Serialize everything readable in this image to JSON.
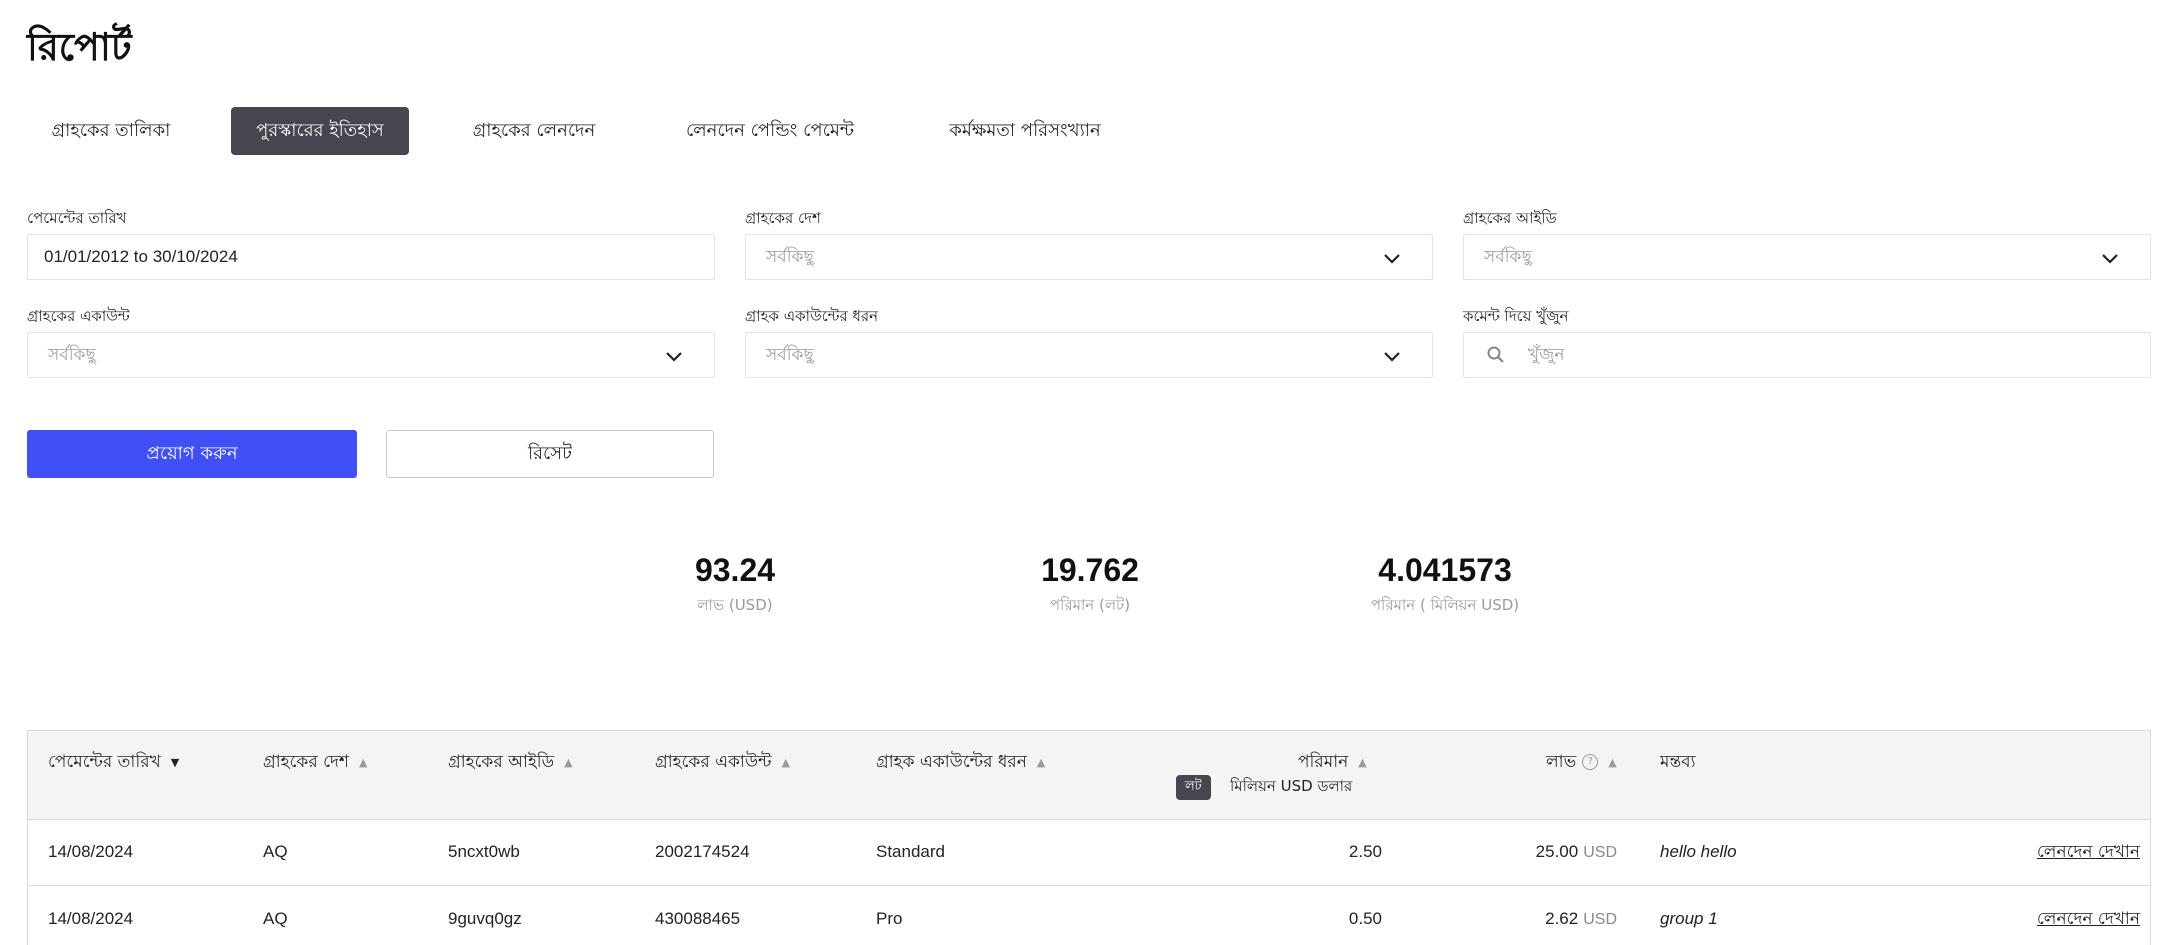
{
  "page_title": "রিপোর্ট",
  "tabs": [
    {
      "label": "গ্রাহকের তালিকা",
      "active": false
    },
    {
      "label": "পুরস্কারের ইতিহাস",
      "active": true
    },
    {
      "label": "গ্রাহকের লেনদেন",
      "active": false
    },
    {
      "label": "লেনদেন পেন্ডিং পেমেন্ট",
      "active": false
    },
    {
      "label": "কর্মক্ষমতা পরিসংখ্যান",
      "active": false
    }
  ],
  "filters": {
    "payment_date": {
      "label": "পেমেন্টের তারিখ",
      "value": "01/01/2012 to 30/10/2024"
    },
    "client_country": {
      "label": "গ্রাহকের দেশ",
      "placeholder": "সর্বকিছু"
    },
    "client_id": {
      "label": "গ্রাহকের আইডি",
      "placeholder": "সর্বকিছু"
    },
    "client_account": {
      "label": "গ্রাহকের একাউন্ট",
      "placeholder": "সর্বকিছু"
    },
    "account_type": {
      "label": "গ্রাহক একাউন্টের ধরন",
      "placeholder": "সর্বকিছু"
    },
    "comment_search": {
      "label": "কমেন্ট দিয়ে খুঁজুন",
      "placeholder": "খুঁজুন"
    }
  },
  "buttons": {
    "apply": "প্রয়োগ করুন",
    "reset": "রিসেট"
  },
  "stats": [
    {
      "value": "93.24",
      "label": "লাভ (USD)"
    },
    {
      "value": "19.762",
      "label": "পরিমান (লট)"
    },
    {
      "value": "4.041573",
      "label": "পরিমান ( মিলিয়ন USD)"
    }
  ],
  "table": {
    "headers": {
      "payment_date": "পেমেন্টের তারিখ",
      "country": "গ্রাহকের দেশ",
      "client_id": "গ্রাহকের আইডি",
      "account": "গ্রাহকের একাউন্ট",
      "account_type": "গ্রাহক একাউন্টের ধরন",
      "volume": "পরিমান",
      "profit": "লাভ",
      "comment": "মন্তব্য"
    },
    "volume_toggle": {
      "lot": "লট",
      "musd": "মিলিয়ন USD ডলার"
    },
    "currency": "USD",
    "rows": [
      {
        "date": "14/08/2024",
        "country": "AQ",
        "client_id": "5ncxt0wb",
        "account": "2002174524",
        "type": "Standard",
        "volume": "2.50",
        "profit": "25.00",
        "comment": "hello hello",
        "action": "লেনদেন দেখান"
      },
      {
        "date": "14/08/2024",
        "country": "AQ",
        "client_id": "9guvq0gz",
        "account": "430088465",
        "type": "Pro",
        "volume": "0.50",
        "profit": "2.62",
        "comment": "group 1",
        "action": "লেনদেন দেখান"
      }
    ]
  }
}
